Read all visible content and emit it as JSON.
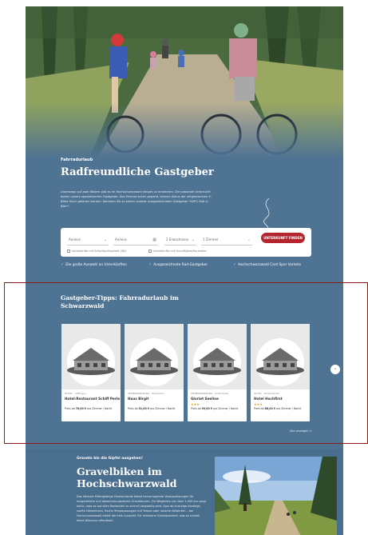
{
  "hero": {
    "eyebrow": "Fahrradurlaub",
    "title": "Radfreundliche Gastgeber",
    "text": "Unterwegs auf zwei Rädern gibt es im Hochschwarzwald einiges zu entdecken. Die passende Unterkunft bieten unsere spezialisierten Gastgeber. Das Fahrrad sicher geparkt, können Akkus der mitgebrachten E-Bikes frisch geladen werden. Kommen Sie zu einem unserer ausgezeichneten Gastgeber \"ADFC Bett & Bike\"!"
  },
  "search": {
    "arrival": "Anreise",
    "departure": "Anreise",
    "guests": "2 Erwachsene",
    "rooms": "1 Zimmer",
    "button": "UNTERKUNFT FINDEN",
    "check1": "Unterkünfte mit Sofortbuchbarkeit (SB)",
    "check2": "Unterkünfte mit Hund/Katze/Haustiere"
  },
  "usps": [
    "Die große Auswahl an Unterkünften",
    "Ausgezeichnete Rad-Gastgeber",
    "Hochschwarzwald Card Spar Vorteile"
  ],
  "section": {
    "title": "Gastgeber-Tipps: Fahrradurlaub im Schwarzwald",
    "more": "Alle anzeigen >"
  },
  "cards": [
    {
      "category": "HOTEL · Löffingen",
      "name": "Hotel-Restaurant Schiff Perle",
      "stars": "",
      "price_prefix": "Preis ab",
      "price": "76,00 €",
      "price_suffix": "pro Zimmer / Nacht"
    },
    {
      "category": "FERIENWOHNUNG · Eisenbach",
      "name": "Haus Birgit",
      "stars": "",
      "price_prefix": "Preis ab",
      "price": "51,00 €",
      "price_suffix": "pro Zimmer / Nacht"
    },
    {
      "category": "FERIENWOHNUNG · Schluchsee",
      "name": "Gloriet Seeline",
      "stars": "★★★",
      "price_prefix": "Preis ab",
      "price": "59,00 €",
      "price_suffix": "pro Zimmer / Nacht"
    },
    {
      "category": "HOTEL · Hinterzarten",
      "name": "Hotel Hochfirst",
      "stars": "★★★",
      "price_prefix": "Preis ab",
      "price": "88,00 €",
      "price_suffix": "pro Zimmer / Nacht"
    }
  ],
  "gravel": {
    "eyebrow": "Graveln bis die Gipfel ausgehen!",
    "title": "Gravelbiken im Hochschwarzwald",
    "text": "Das höchste Mittelgebirge Deutschlands bietet hervorragende Voraussetzungen für ausgedehnte und abwechslungsreiche Graveltouren. Ein Wegenetz von über 1.000 km sorgt dafür, dass es auf allen Radrouten zu schnell langweilig wird. Egal ob knackige Anstiege, sanfte Höhenlinien, flache Tempopassagen mit Tempo oder rasante Abfahrten – der Hochschwarzwald bietet die freie Auswahl. Für erfahrene Gravelpioniere, was so schnell keine Wünsche offenlässt!"
  },
  "icons": {
    "calendar": "calendar-icon",
    "chevron": "chevron-down-icon",
    "check": "check-icon",
    "next": "chevron-right-icon"
  },
  "colors": {
    "background": "#4f7393",
    "accent": "#b5252e",
    "highlight_border": "#8b1a1a"
  }
}
